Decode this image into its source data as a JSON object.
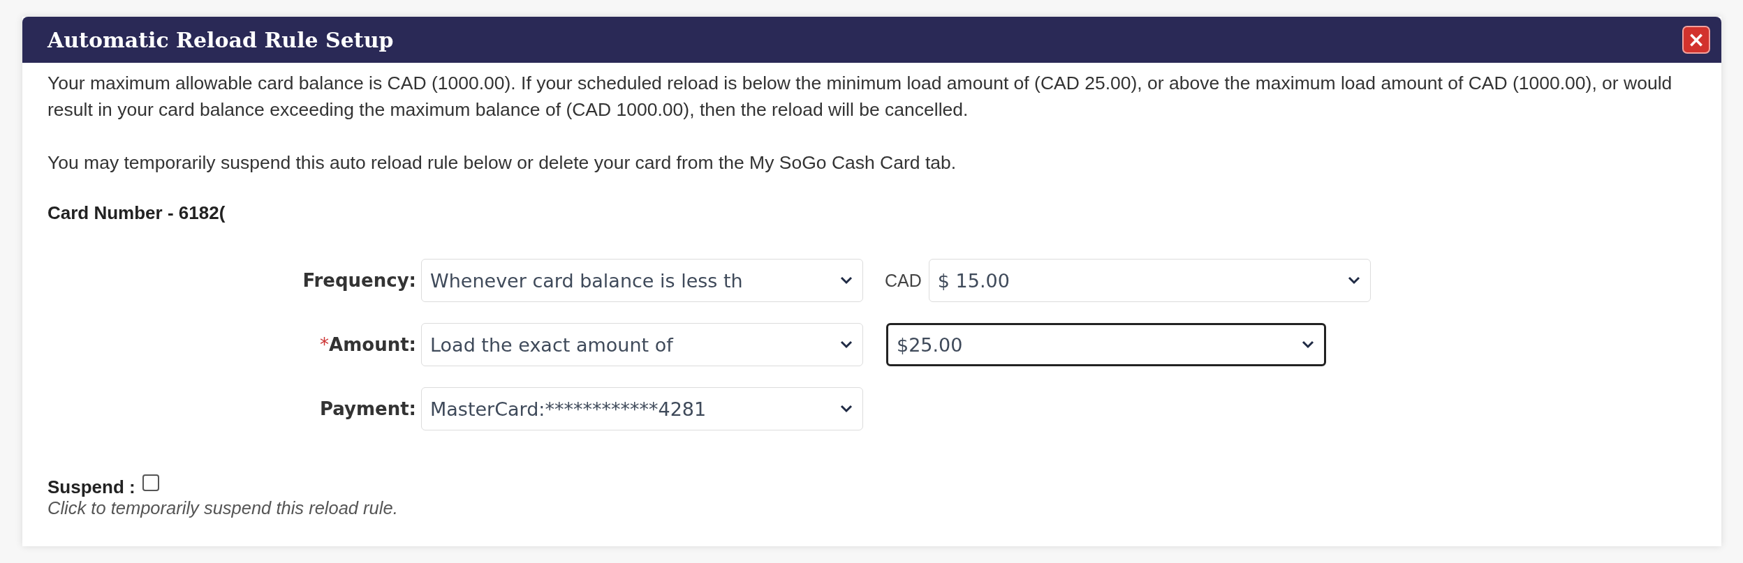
{
  "dialog": {
    "title": "Automatic Reload Rule Setup",
    "close_label": "×"
  },
  "paragraphs": [
    "Your maximum allowable card balance is CAD (1000.00). If your scheduled reload is below the minimum load amount of (CAD 25.00), or above the maximum load amount of CAD (1000.00), or would result in your card balance exceeding the maximum balance of (CAD 1000.00), then the reload will be cancelled.",
    "You may temporarily suspend this auto reload rule below or delete your card from the My SoGo Cash Card tab."
  ],
  "card_number": "Card Number - 6182(",
  "fields": [
    {
      "label": "Frequency:",
      "select": {
        "value": "Whenever card balance is less th",
        "focused": false
      },
      "prefix": "CAD",
      "second_select": {
        "value": "$ 15.00",
        "focused": false
      }
    },
    {
      "label": "Amount:",
      "required_mark": "*",
      "select": {
        "value": "Load the exact amount of",
        "focused": false
      },
      "second_select": {
        "value": "$25.00",
        "focused": true
      }
    },
    {
      "label": "Payment:",
      "select": {
        "value": "MasterCard:************4281",
        "focused": false
      }
    }
  ],
  "suspend": {
    "label": "Suspend :",
    "checked": false,
    "hint": "Click to temporarily suspend this reload rule."
  }
}
